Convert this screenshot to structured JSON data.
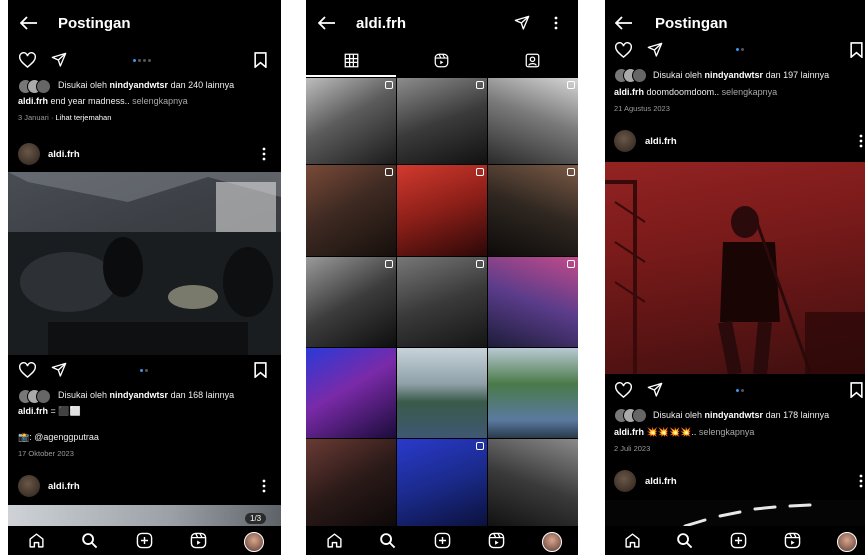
{
  "left": {
    "header_title": "Postingan",
    "post1": {
      "likes": "Disukai oleh",
      "liker": "nindyandwtsr",
      "others": "dan 240 lainnya",
      "username": "aldi.frh",
      "caption": "end year madness..",
      "more": "selengkapnya",
      "date": "3 Januari",
      "translate": "Lihat terjemahan"
    },
    "post2_author": "aldi.frh",
    "post2": {
      "likes": "Disukai oleh",
      "liker": "nindyandwtsr",
      "others": "dan 168 lainnya",
      "username": "aldi.frh",
      "caption": "= ⬛⬜",
      "credit": "📸: @agenggputraa",
      "date": "17 Oktober 2023"
    },
    "post3_author": "aldi.frh",
    "counter": "1/3"
  },
  "middle": {
    "profile_name": "aldi.frh"
  },
  "right": {
    "header_title": "Postingan",
    "post1": {
      "likes": "Disukai oleh",
      "liker": "nindyandwtsr",
      "others": "dan 197 lainnya",
      "username": "aldi.frh",
      "caption": "doomdoomdoom..",
      "more": "selengkapnya",
      "date": "21 Agustus 2023"
    },
    "post2_author": "aldi.frh",
    "post2": {
      "likes": "Disukai oleh",
      "liker": "nindyandwtsr",
      "others": "dan 178 lainnya",
      "username": "aldi.frh",
      "caption": "💥💥💥💥..",
      "more": "selengkapnya",
      "date": "2 Juli 2023"
    },
    "post3_author": "aldi.frh"
  },
  "icons": [
    "back-arrow-icon",
    "heart-icon",
    "send-icon",
    "bookmark-icon",
    "more-icon",
    "home-icon",
    "search-icon",
    "create-icon",
    "reels-icon",
    "grid-icon",
    "tagged-icon",
    "profile-avatar"
  ],
  "colors": {
    "background": "#000000",
    "text": "#f5f5f5",
    "muted": "#a8a8a8",
    "active_dot": "#3897f0"
  }
}
